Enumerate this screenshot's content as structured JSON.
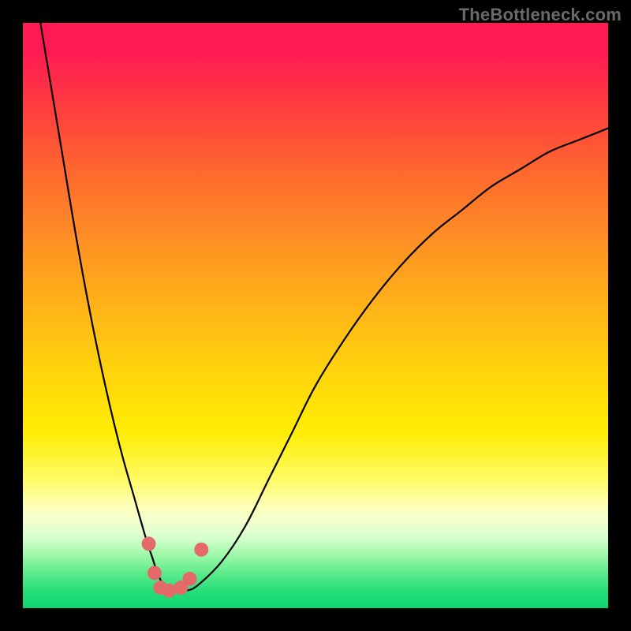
{
  "watermark": "TheBottleneck.com",
  "chart_data": {
    "type": "line",
    "title": "",
    "xlabel": "",
    "ylabel": "",
    "xlim": [
      0,
      100
    ],
    "ylim": [
      0,
      100
    ],
    "series": [
      {
        "name": "curve",
        "x": [
          3,
          5,
          7,
          9,
          11,
          13,
          15,
          17,
          19,
          21,
          22,
          23,
          24,
          25,
          26,
          28,
          30,
          34,
          38,
          42,
          46,
          50,
          55,
          60,
          65,
          70,
          75,
          80,
          85,
          90,
          95,
          100
        ],
        "values": [
          100,
          88,
          76,
          64,
          53,
          43,
          34,
          26,
          19,
          12,
          9,
          6,
          4,
          3,
          3,
          3,
          4,
          8,
          14,
          22,
          30,
          38,
          46,
          53,
          59,
          64,
          68,
          72,
          75,
          78,
          80,
          82
        ]
      }
    ],
    "markers": {
      "name": "dots",
      "color": "#e46a6a",
      "points": [
        {
          "x": 21.5,
          "y": 11
        },
        {
          "x": 22.5,
          "y": 6
        },
        {
          "x": 23.5,
          "y": 3.5
        },
        {
          "x": 25.0,
          "y": 3
        },
        {
          "x": 27.0,
          "y": 3.5
        },
        {
          "x": 28.5,
          "y": 5
        },
        {
          "x": 30.5,
          "y": 10
        }
      ]
    },
    "background_gradient": {
      "stops": [
        {
          "pos": 0,
          "color": "#ff1a52"
        },
        {
          "pos": 5,
          "color": "#ff1a52"
        },
        {
          "pos": 14,
          "color": "#ff3b3f"
        },
        {
          "pos": 26,
          "color": "#ff6a2e"
        },
        {
          "pos": 37,
          "color": "#ff8f24"
        },
        {
          "pos": 48,
          "color": "#ffb218"
        },
        {
          "pos": 59,
          "color": "#ffd20c"
        },
        {
          "pos": 70,
          "color": "#ffed04"
        },
        {
          "pos": 78,
          "color": "#fffb64"
        },
        {
          "pos": 82,
          "color": "#ffffb0"
        },
        {
          "pos": 85,
          "color": "#f4ffce"
        },
        {
          "pos": 88,
          "color": "#d6ffcd"
        },
        {
          "pos": 91,
          "color": "#9cf8a8"
        },
        {
          "pos": 94,
          "color": "#5deb8d"
        },
        {
          "pos": 97,
          "color": "#27de79"
        },
        {
          "pos": 100,
          "color": "#0fd66e"
        }
      ]
    }
  }
}
